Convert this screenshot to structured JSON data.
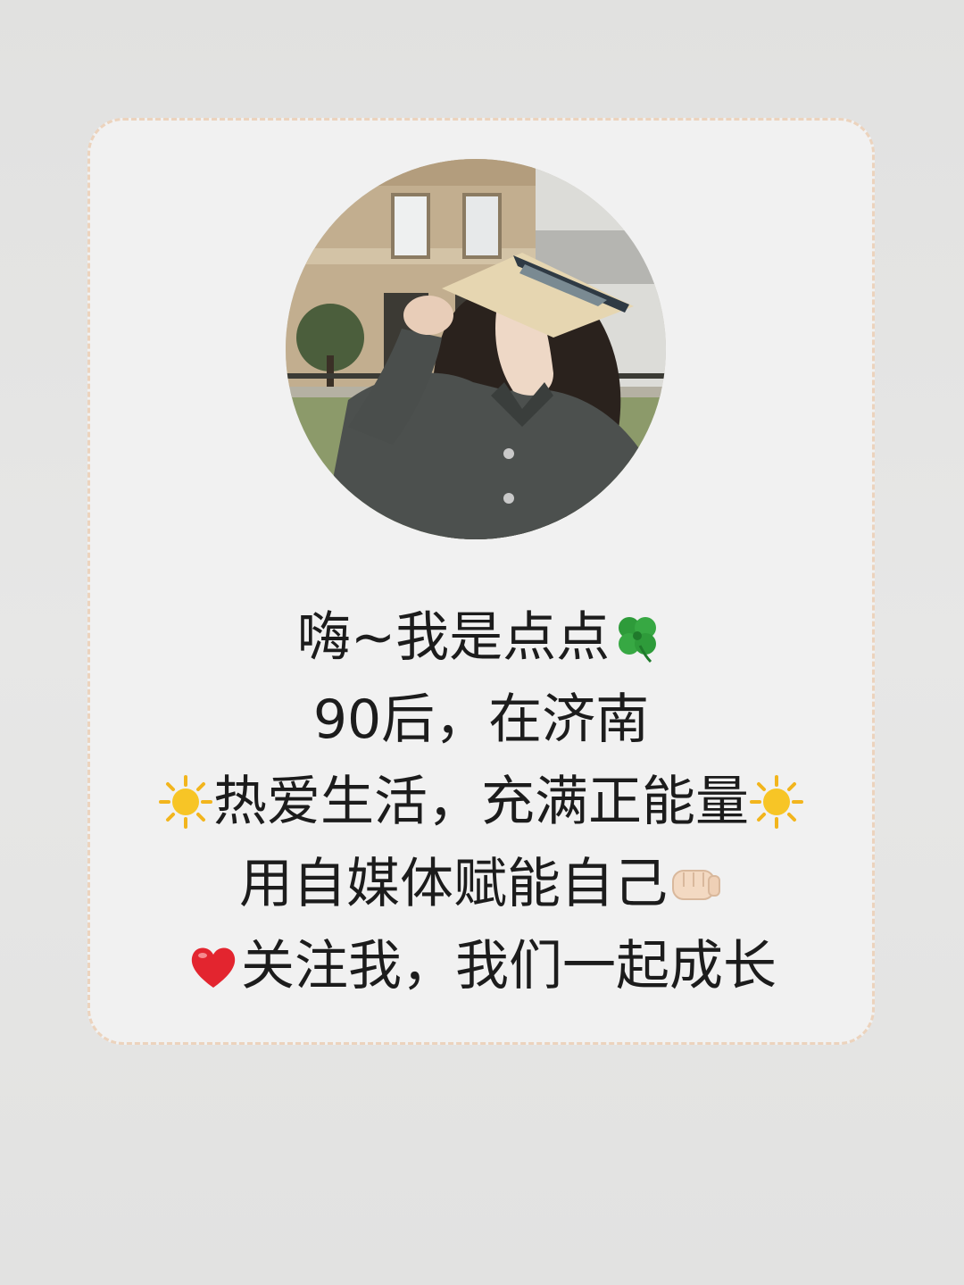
{
  "profile": {
    "avatar_icon": "profile-photo",
    "lines": [
      {
        "text": "嗨~我是点点",
        "trailing_icon": "four-leaf-clover-icon"
      },
      {
        "text": "90后，在济南"
      },
      {
        "leading_icon": "sun-icon",
        "text": "热爱生活，充满正能量",
        "trailing_icon": "sun-icon"
      },
      {
        "text": "用自媒体赋能自己",
        "trailing_icon": "fist-icon"
      },
      {
        "leading_icon": "heart-icon",
        "text": "关注我，我们一起成长"
      }
    ]
  },
  "colors": {
    "page_background": "#e4e4e3",
    "card_background": "#f1f1f1",
    "card_border": "#ecd3bd",
    "text": "#1c1c1c"
  }
}
